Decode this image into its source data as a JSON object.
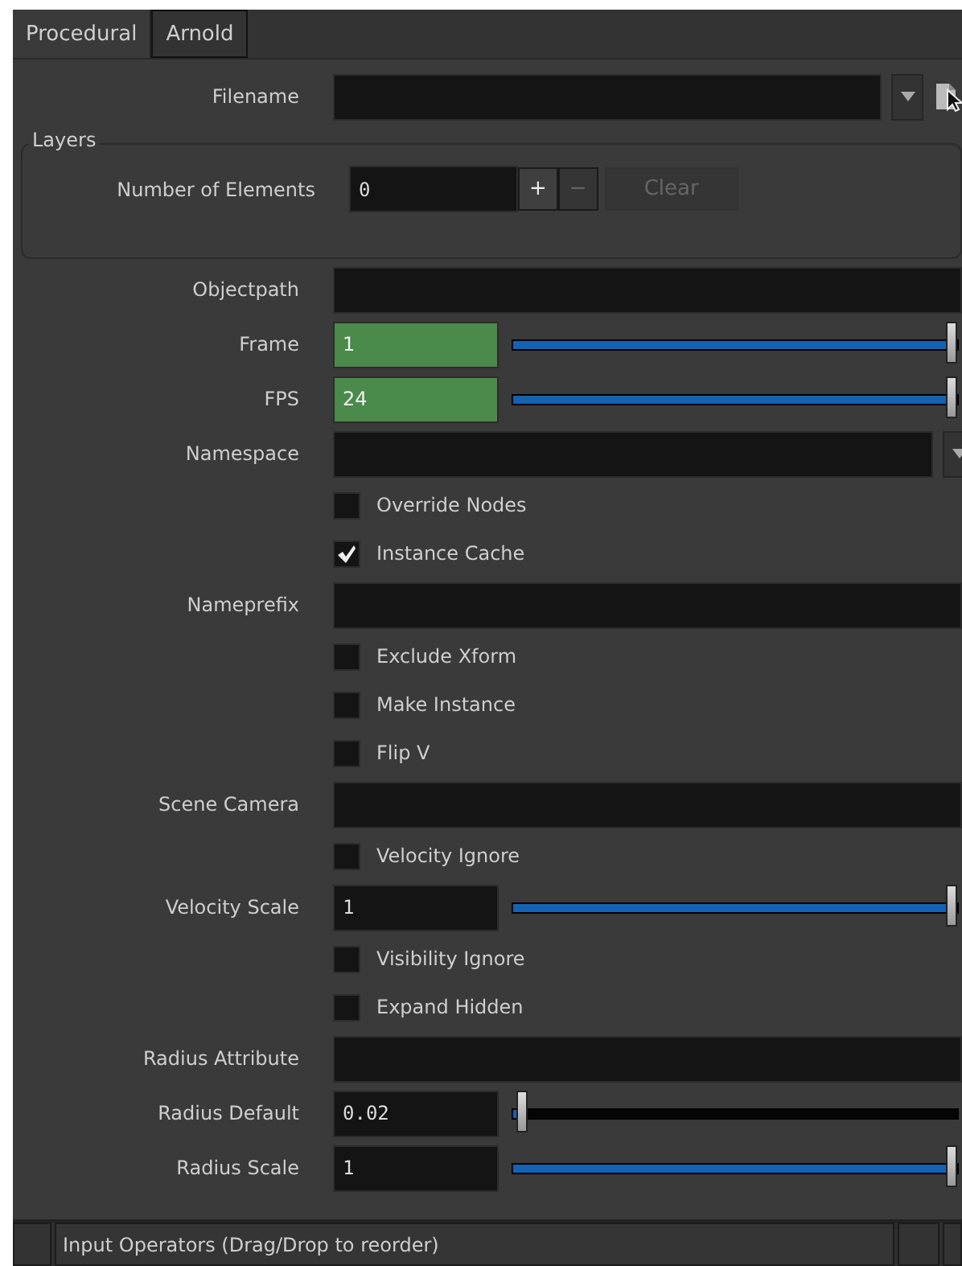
{
  "tabs": [
    {
      "label": "Procedural",
      "selected": true
    },
    {
      "label": "Arnold",
      "selected": false
    }
  ],
  "filename": {
    "label": "Filename"
  },
  "layers": {
    "title": "Layers",
    "label": "Number of Elements",
    "value": "0",
    "buttons": [
      {
        "label": "+",
        "disabled": false
      },
      {
        "label": "−",
        "disabled": true
      },
      {
        "label": "Clear",
        "disabled": true
      }
    ]
  },
  "parameters": [
    {
      "kind": "string",
      "label": "Objectpath"
    },
    {
      "kind": "slider",
      "label": "Frame",
      "value": "1",
      "animated": true,
      "level": 1
    },
    {
      "kind": "slider",
      "label": "FPS",
      "value": "24",
      "animated": true,
      "level": 1
    },
    {
      "kind": "menu",
      "label": "Namespace"
    },
    {
      "kind": "checkbox",
      "label": "Override Nodes",
      "checked": false
    },
    {
      "kind": "checkbox",
      "label": "Instance Cache",
      "checked": true
    },
    {
      "kind": "string",
      "label": "Nameprefix"
    },
    {
      "kind": "checkbox",
      "label": "Exclude Xform",
      "checked": false
    },
    {
      "kind": "checkbox",
      "label": "Make Instance",
      "checked": false
    },
    {
      "kind": "checkbox",
      "label": "Flip V",
      "checked": false
    },
    {
      "kind": "string",
      "label": "Scene Camera"
    },
    {
      "kind": "checkbox",
      "label": "Velocity Ignore",
      "checked": false
    },
    {
      "kind": "slider",
      "label": "Velocity Scale",
      "value": "1",
      "animated": false,
      "level": 1
    },
    {
      "kind": "checkbox",
      "label": "Visibility Ignore",
      "checked": false
    },
    {
      "kind": "checkbox",
      "label": "Expand Hidden",
      "checked": false
    },
    {
      "kind": "string",
      "label": "Radius Attribute"
    },
    {
      "kind": "slider",
      "label": "Radius Default",
      "value": "0.02",
      "animated": false,
      "level": 0.02
    },
    {
      "kind": "slider",
      "label": "Radius Scale",
      "value": "1",
      "animated": false,
      "level": 1
    }
  ],
  "input_list": {
    "label": "Input Operators (Drag/Drop to reorder)"
  }
}
